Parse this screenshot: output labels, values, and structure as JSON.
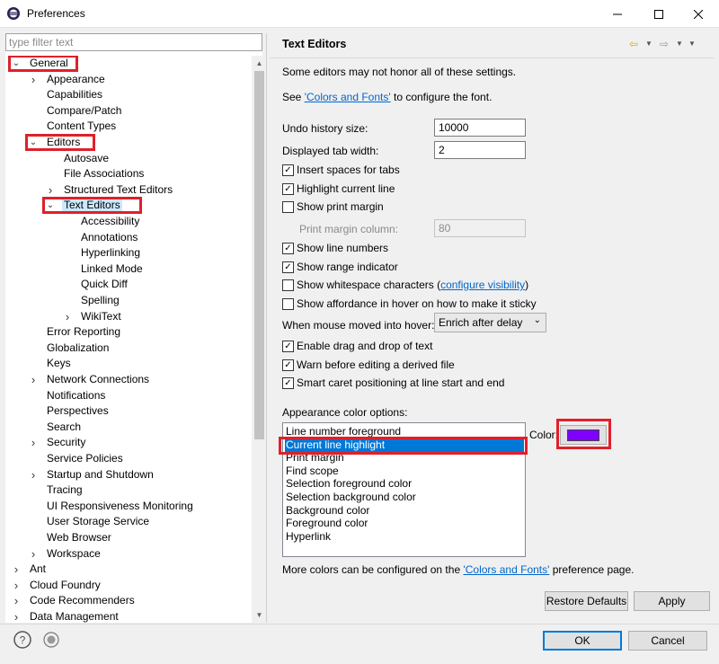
{
  "window": {
    "title": "Preferences"
  },
  "filter": {
    "placeholder": "type filter text"
  },
  "tree": [
    {
      "label": "General",
      "level": 0,
      "expanded": true,
      "highlight": true
    },
    {
      "label": "Appearance",
      "level": 1,
      "twisty": "collapsed"
    },
    {
      "label": "Capabilities",
      "level": 1
    },
    {
      "label": "Compare/Patch",
      "level": 1
    },
    {
      "label": "Content Types",
      "level": 1
    },
    {
      "label": "Editors",
      "level": 1,
      "expanded": true,
      "highlight": true
    },
    {
      "label": "Autosave",
      "level": 2
    },
    {
      "label": "File Associations",
      "level": 2
    },
    {
      "label": "Structured Text Editors",
      "level": 2,
      "twisty": "collapsed"
    },
    {
      "label": "Text Editors",
      "level": 2,
      "expanded": true,
      "highlight": true,
      "selected": true
    },
    {
      "label": "Accessibility",
      "level": 3
    },
    {
      "label": "Annotations",
      "level": 3
    },
    {
      "label": "Hyperlinking",
      "level": 3
    },
    {
      "label": "Linked Mode",
      "level": 3
    },
    {
      "label": "Quick Diff",
      "level": 3
    },
    {
      "label": "Spelling",
      "level": 3
    },
    {
      "label": "WikiText",
      "level": 3,
      "twisty": "collapsed"
    },
    {
      "label": "Error Reporting",
      "level": 1
    },
    {
      "label": "Globalization",
      "level": 1
    },
    {
      "label": "Keys",
      "level": 1
    },
    {
      "label": "Network Connections",
      "level": 1,
      "twisty": "collapsed"
    },
    {
      "label": "Notifications",
      "level": 1
    },
    {
      "label": "Perspectives",
      "level": 1
    },
    {
      "label": "Search",
      "level": 1
    },
    {
      "label": "Security",
      "level": 1,
      "twisty": "collapsed"
    },
    {
      "label": "Service Policies",
      "level": 1
    },
    {
      "label": "Startup and Shutdown",
      "level": 1,
      "twisty": "collapsed"
    },
    {
      "label": "Tracing",
      "level": 1
    },
    {
      "label": "UI Responsiveness Monitoring",
      "level": 1
    },
    {
      "label": "User Storage Service",
      "level": 1
    },
    {
      "label": "Web Browser",
      "level": 1
    },
    {
      "label": "Workspace",
      "level": 1,
      "twisty": "collapsed"
    },
    {
      "label": "Ant",
      "level": 0,
      "twisty": "collapsed"
    },
    {
      "label": "Cloud Foundry",
      "level": 0,
      "twisty": "collapsed"
    },
    {
      "label": "Code Recommenders",
      "level": 0,
      "twisty": "collapsed"
    },
    {
      "label": "Data Management",
      "level": 0,
      "twisty": "collapsed"
    }
  ],
  "page": {
    "title": "Text Editors",
    "note": "Some editors may not honor all of these settings.",
    "see_prefix": "See ",
    "see_link": "'Colors and Fonts'",
    "see_suffix": " to configure the font.",
    "undo_label": "Undo history size:",
    "undo_value": "10000",
    "tab_label": "Displayed tab width:",
    "tab_value": "2",
    "print_margin_col_label": "Print margin column:",
    "print_margin_col_value": "80",
    "hover_label": "When mouse moved into hover:",
    "hover_value": "Enrich after delay",
    "color_options_label": "Appearance color options:",
    "color_label": "Color:",
    "color_value": "#8000ff",
    "more_colors_prefix": "More colors can be configured on the ",
    "more_colors_link": "'Colors and Fonts'",
    "more_colors_suffix": " preference page."
  },
  "checks": {
    "insert_spaces": {
      "label": "Insert spaces for tabs",
      "checked": true
    },
    "highlight_line": {
      "label": "Highlight current line",
      "checked": true
    },
    "show_print_margin": {
      "label": "Show print margin",
      "checked": false
    },
    "show_line_numbers": {
      "label": "Show line numbers",
      "checked": true
    },
    "show_range": {
      "label": "Show range indicator",
      "checked": true
    },
    "show_whitespace": {
      "label": "Show whitespace characters (",
      "link": "configure visibility",
      "suffix": ")",
      "checked": false
    },
    "show_affordance": {
      "label": "Show affordance in hover on how to make it sticky",
      "checked": false
    },
    "drag_drop": {
      "label": "Enable drag and drop of text",
      "checked": true
    },
    "warn_derived": {
      "label": "Warn before editing a derived file",
      "checked": true
    },
    "smart_caret": {
      "label": "Smart caret positioning at line start and end",
      "checked": true
    }
  },
  "color_list": [
    "Line number foreground",
    "Current line highlight",
    "Print margin",
    "Find scope",
    "Selection foreground color",
    "Selection background color",
    "Background color",
    "Foreground color",
    "Hyperlink"
  ],
  "buttons": {
    "restore": "Restore Defaults",
    "apply": "Apply",
    "ok": "OK",
    "cancel": "Cancel"
  },
  "colors": {
    "highlight_red": "#e0202a",
    "selection_blue": "#0078d7",
    "link_blue": "#0066cc"
  }
}
